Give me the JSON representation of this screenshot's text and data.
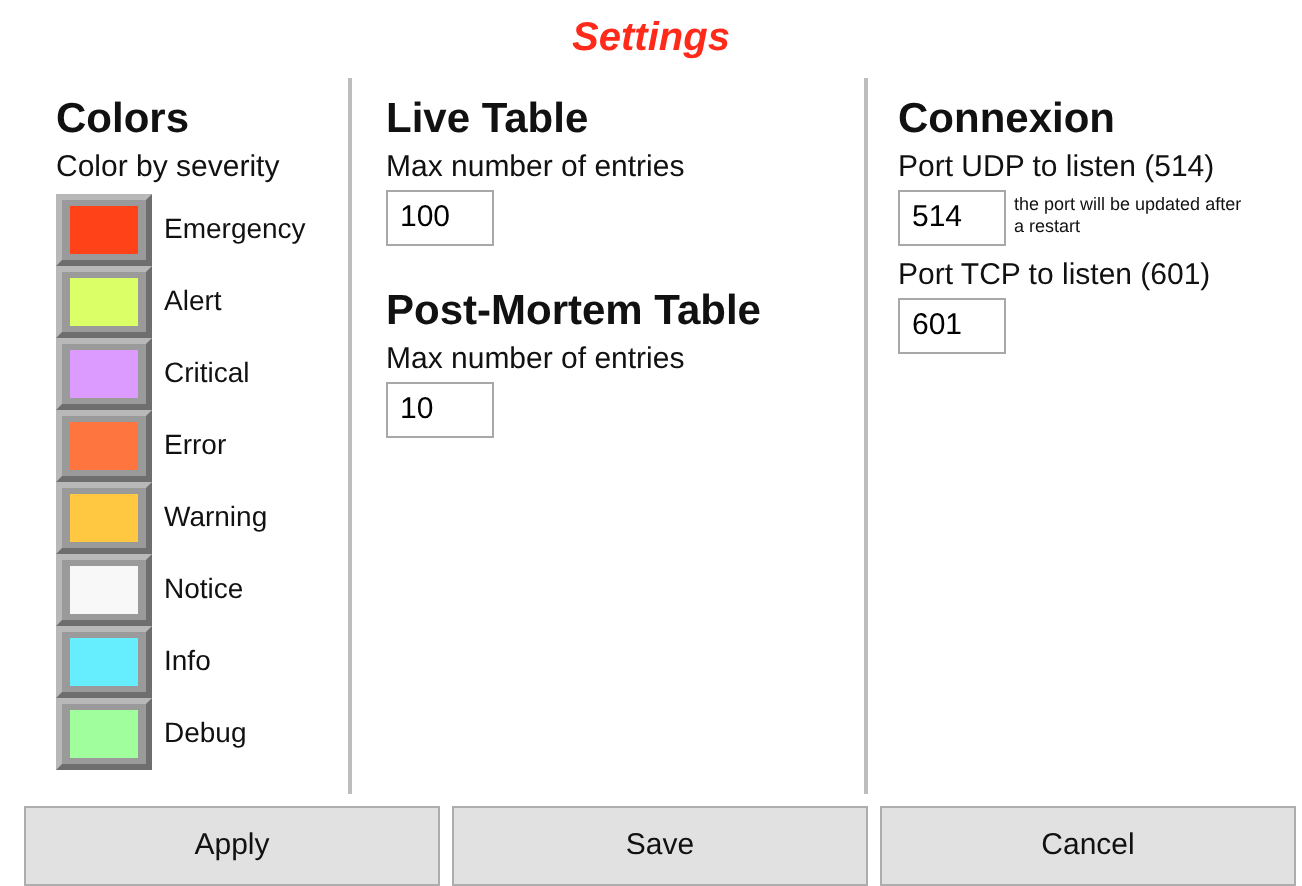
{
  "title": "Settings",
  "colors": {
    "heading": "Colors",
    "subheading": "Color by severity",
    "severities": [
      {
        "label": "Emergency",
        "color": "#ff4217"
      },
      {
        "label": "Alert",
        "color": "#dbff66"
      },
      {
        "label": "Critical",
        "color": "#dc9cff"
      },
      {
        "label": "Error",
        "color": "#ff7540"
      },
      {
        "label": "Warning",
        "color": "#ffc840"
      },
      {
        "label": "Notice",
        "color": "#f8f8f8"
      },
      {
        "label": "Info",
        "color": "#66eeff"
      },
      {
        "label": "Debug",
        "color": "#a0ff9c"
      }
    ]
  },
  "live_table": {
    "heading": "Live Table",
    "label": "Max number of entries",
    "value": "100"
  },
  "post_mortem_table": {
    "heading": "Post-Mortem Table",
    "label": "Max number of entries",
    "value": "10"
  },
  "connexion": {
    "heading": "Connexion",
    "udp_label": "Port UDP to listen (514)",
    "udp_value": "514",
    "udp_note": "the port will be updated after a restart",
    "tcp_label": "Port TCP to listen (601)",
    "tcp_value": "601"
  },
  "buttons": [
    "Apply",
    "Save",
    "Cancel"
  ]
}
